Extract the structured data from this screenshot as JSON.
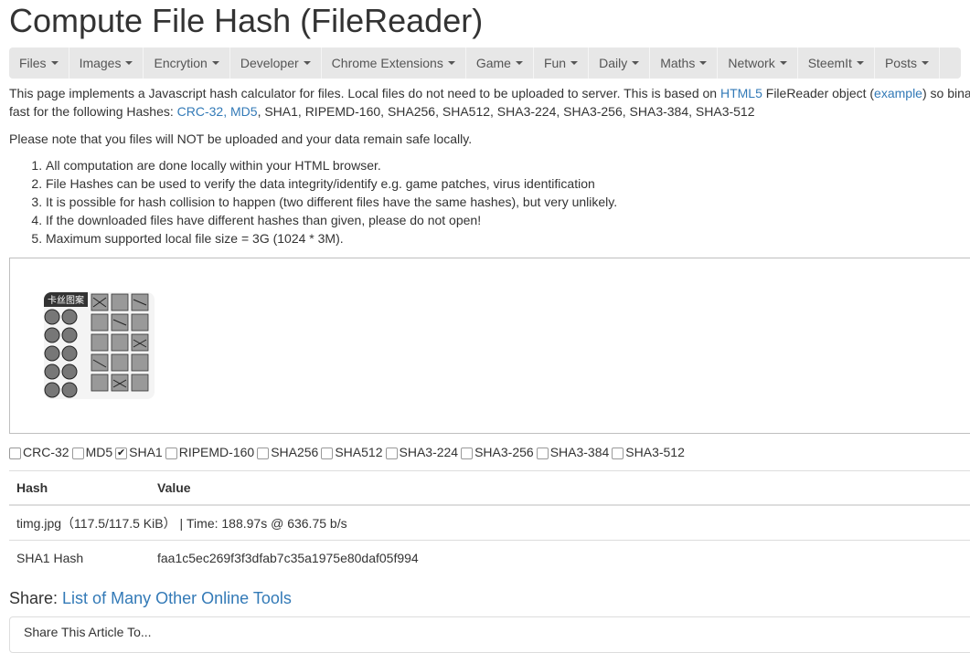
{
  "page": {
    "title": "Compute File Hash (FileReader)"
  },
  "nav": [
    {
      "label": "Files"
    },
    {
      "label": "Images"
    },
    {
      "label": "Encrytion"
    },
    {
      "label": "Developer"
    },
    {
      "label": "Chrome Extensions"
    },
    {
      "label": "Game"
    },
    {
      "label": "Fun"
    },
    {
      "label": "Daily"
    },
    {
      "label": "Maths"
    },
    {
      "label": "Network"
    },
    {
      "label": "SteemIt"
    },
    {
      "label": "Posts"
    }
  ],
  "intro": {
    "t1": "This page implements a Javascript hash calculator for files. Local files do not need to be uploaded to server. This is based on ",
    "link_html5": "HTML5",
    "t2": " FileReader object (",
    "link_example": "example",
    "t3": ") so binary ",
    "t4": "fast for the following Hashes: ",
    "link_crc_md5": "CRC-32, MD5",
    "t5": ", SHA1, RIPEMD-160, SHA256, SHA512, SHA3-224, SHA3-256, SHA3-384, SHA3-512"
  },
  "note": "Please note that you files will NOT be uploaded and your data remain safe locally.",
  "points": [
    "All computation are done locally within your HTML browser.",
    "File Hashes can be used to verify the data integrity/identify e.g. game patches, virus identification",
    "It is possible for hash collision to happen (two different files have the same hashes), but very unlikely.",
    "If the downloaded files have different hashes than given, please do not open!",
    "Maximum supported local file size = 3G (1024 * 3M)."
  ],
  "thumbnail": {
    "caption": "卡丝图案"
  },
  "algorithms": [
    {
      "label": "CRC-32",
      "checked": false
    },
    {
      "label": "MD5",
      "checked": false
    },
    {
      "label": "SHA1",
      "checked": true
    },
    {
      "label": "RIPEMD-160",
      "checked": false
    },
    {
      "label": "SHA256",
      "checked": false
    },
    {
      "label": "SHA512",
      "checked": false
    },
    {
      "label": "SHA3-224",
      "checked": false
    },
    {
      "label": "SHA3-256",
      "checked": false
    },
    {
      "label": "SHA3-384",
      "checked": false
    },
    {
      "label": "SHA3-512",
      "checked": false
    }
  ],
  "results": {
    "headers": {
      "hash": "Hash",
      "value": "Value"
    },
    "file_row": {
      "name": "timg.jpg",
      "size": "（117.5/117.5 KiB）",
      "time": " | Time: 188.97s @ 636.75 b/s"
    },
    "hash_row": {
      "label": "SHA1 Hash",
      "value": "faa1c5ec269f3f3dfab7c35a1975e80daf05f994"
    }
  },
  "share": {
    "label": "Share: ",
    "link": "List of Many Other Online Tools",
    "box": "Share This Article To..."
  }
}
